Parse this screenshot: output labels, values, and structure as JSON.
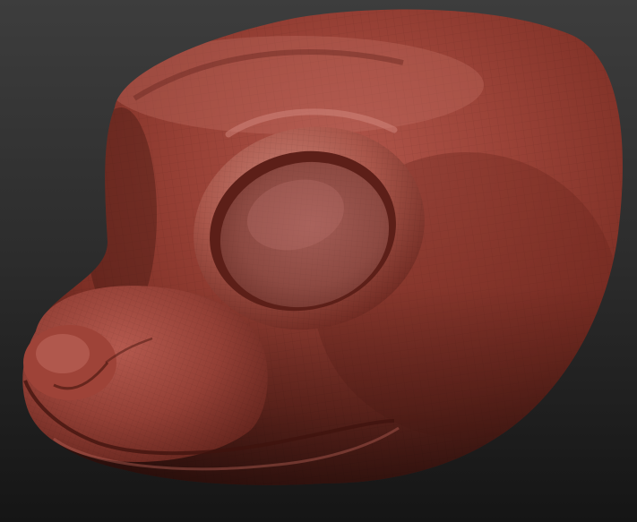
{
  "canvas": {
    "description_free": true,
    "background_colors": {
      "top": "#3c3c3c",
      "bottom": "#141414"
    },
    "model": {
      "subject": "sculpted-animal-head",
      "material": "clay",
      "base_color": "#8e3a31",
      "shadow_color": "#3c1510",
      "highlight_color": "#c4776c",
      "wireframe": true
    }
  }
}
